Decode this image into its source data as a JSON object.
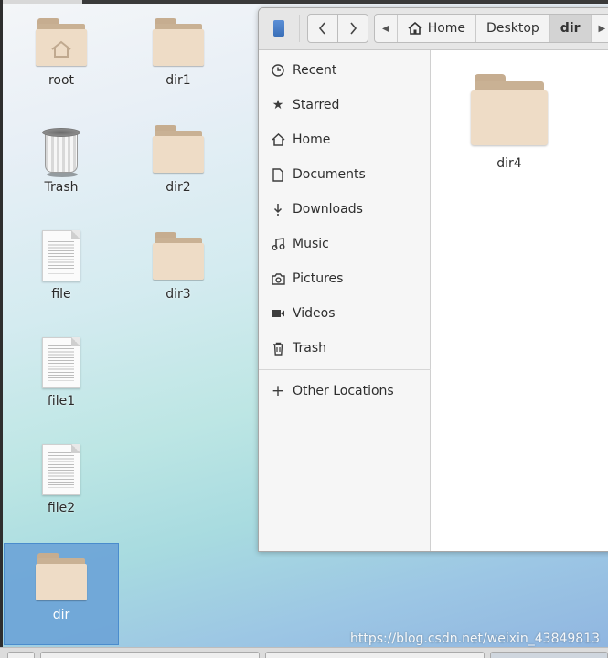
{
  "desktop": {
    "icons": [
      {
        "label": "root"
      },
      {
        "label": "dir1"
      },
      {
        "label": "Trash"
      },
      {
        "label": "dir2"
      },
      {
        "label": "file"
      },
      {
        "label": "dir3"
      },
      {
        "label": "file1"
      },
      {
        "label": "file2"
      },
      {
        "label": "dir"
      }
    ]
  },
  "file_manager": {
    "breadcrumb": [
      "Home",
      "Desktop",
      "dir"
    ],
    "sidebar": {
      "items": [
        {
          "label": "Recent",
          "icon": "clock-icon"
        },
        {
          "label": "Starred",
          "icon": "star-icon"
        },
        {
          "label": "Home",
          "icon": "home-icon"
        },
        {
          "label": "Documents",
          "icon": "document-icon"
        },
        {
          "label": "Downloads",
          "icon": "download-icon"
        },
        {
          "label": "Music",
          "icon": "music-icon"
        },
        {
          "label": "Pictures",
          "icon": "camera-icon"
        },
        {
          "label": "Videos",
          "icon": "video-icon"
        },
        {
          "label": "Trash",
          "icon": "trash-icon"
        }
      ],
      "other": {
        "label": "Other Locations",
        "icon": "plus-icon"
      }
    },
    "content": {
      "items": [
        {
          "label": "dir4"
        }
      ]
    }
  },
  "watermark": "https://blog.csdn.net/weixin_43849813",
  "colors": {
    "folder_front": "#eedcc6",
    "folder_tab": "#c6ad90",
    "selection": "#6ca4d7"
  }
}
